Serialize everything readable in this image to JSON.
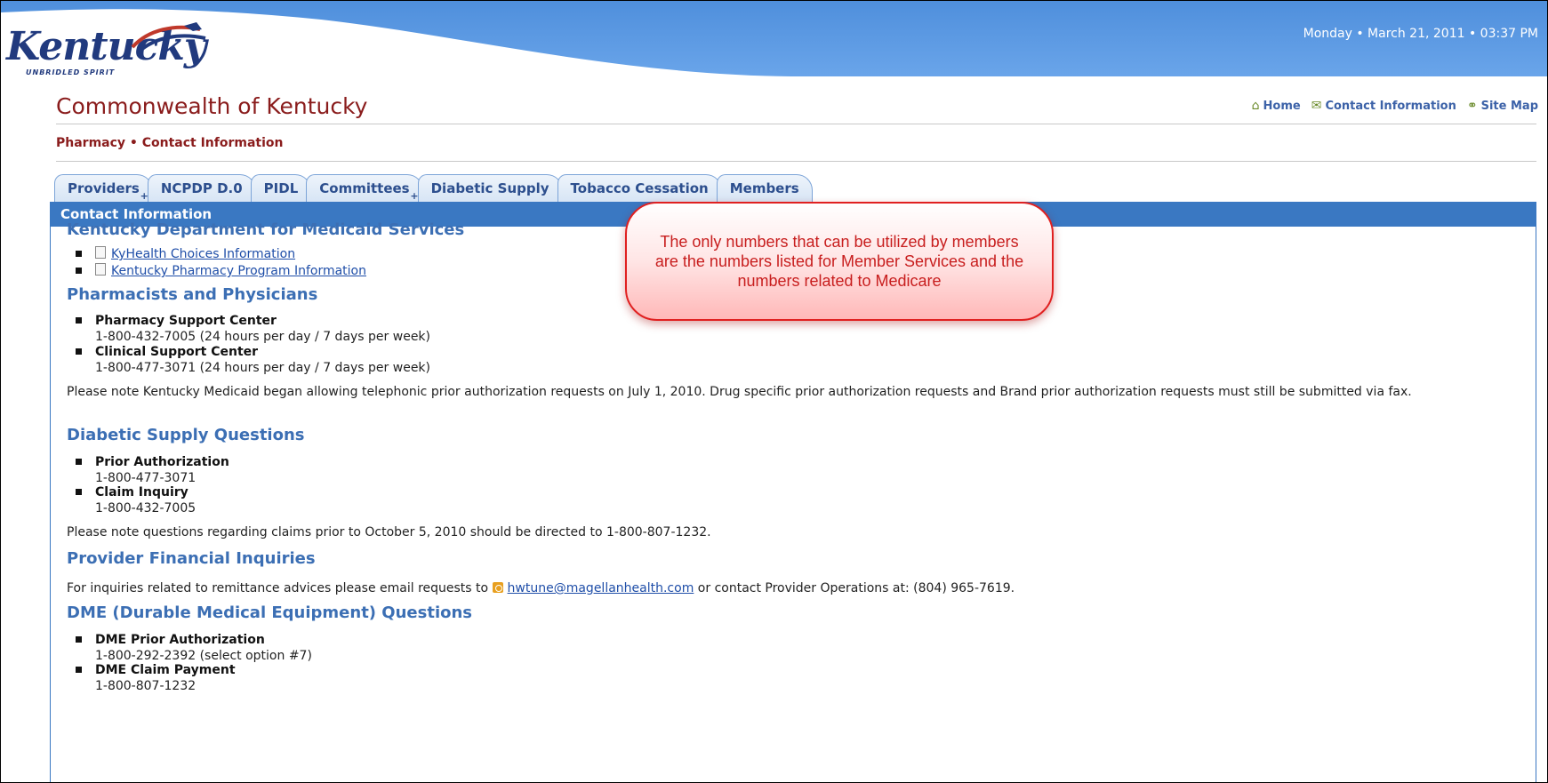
{
  "header": {
    "logo_word": "Kentucky",
    "logo_tagline": "UNBRIDLED SPIRIT",
    "datetime": "Monday • March 21, 2011 • 03:37 PM",
    "site_title": "Commonwealth of Kentucky",
    "links": {
      "home": "Home",
      "contact": "Contact Information",
      "sitemap": "Site Map"
    },
    "breadcrumb": "Pharmacy • Contact Information"
  },
  "tabs": [
    {
      "label": "Providers",
      "has_submenu": true
    },
    {
      "label": "NCPDP D.0",
      "has_submenu": false
    },
    {
      "label": "PIDL",
      "has_submenu": false
    },
    {
      "label": "Committees",
      "has_submenu": true
    },
    {
      "label": "Diabetic Supply",
      "has_submenu": false
    },
    {
      "label": "Tobacco Cessation",
      "has_submenu": false
    },
    {
      "label": "Members",
      "has_submenu": false
    }
  ],
  "panel_title": "Contact Information",
  "sections": {
    "dms": {
      "heading": "Kentucky Department for Medicaid Services",
      "links": [
        "KyHealth Choices Information",
        "Kentucky Pharmacy Program Information"
      ]
    },
    "pharmacists": {
      "heading": "Pharmacists and Physicians",
      "items": [
        {
          "title": "Pharmacy Support Center",
          "detail": "1-800-432-7005 (24 hours per day / 7 days per week)"
        },
        {
          "title": "Clinical Support Center",
          "detail": "1-800-477-3071 (24 hours per day / 7 days per week)"
        }
      ],
      "note": "Please note Kentucky Medicaid began allowing telephonic prior authorization requests on July 1, 2010. Drug specific prior authorization requests and Brand prior authorization requests must still be submitted via fax."
    },
    "diabetic": {
      "heading": "Diabetic Supply Questions",
      "items": [
        {
          "title": "Prior Authorization",
          "detail": "1-800-477-3071"
        },
        {
          "title": "Claim Inquiry",
          "detail": "1-800-432-7005"
        }
      ],
      "note": "Please note questions regarding claims prior to October 5, 2010 should be directed to 1-800-807-1232."
    },
    "financial": {
      "heading": "Provider Financial Inquiries",
      "text_before": "For inquiries related to remittance advices please email requests to",
      "email": "hwtune@magellanhealth.com",
      "text_after": "or contact Provider Operations at: (804) 965-7619."
    },
    "dme": {
      "heading": "DME (Durable Medical Equipment) Questions",
      "items": [
        {
          "title": "DME Prior Authorization",
          "detail": "1-800-292-2392 (select option #7)"
        },
        {
          "title": "DME Claim Payment",
          "detail": "1-800-807-1232"
        }
      ]
    }
  },
  "callout": "The only numbers that can be utilized by members are the numbers listed for Member Services and the numbers related to Medicare",
  "colors": {
    "header_blue": "#5a98e0",
    "title_red": "#8a1c1c",
    "section_blue": "#3c6fb4",
    "bar_blue": "#3a78c2",
    "callout_red": "#e02020"
  }
}
